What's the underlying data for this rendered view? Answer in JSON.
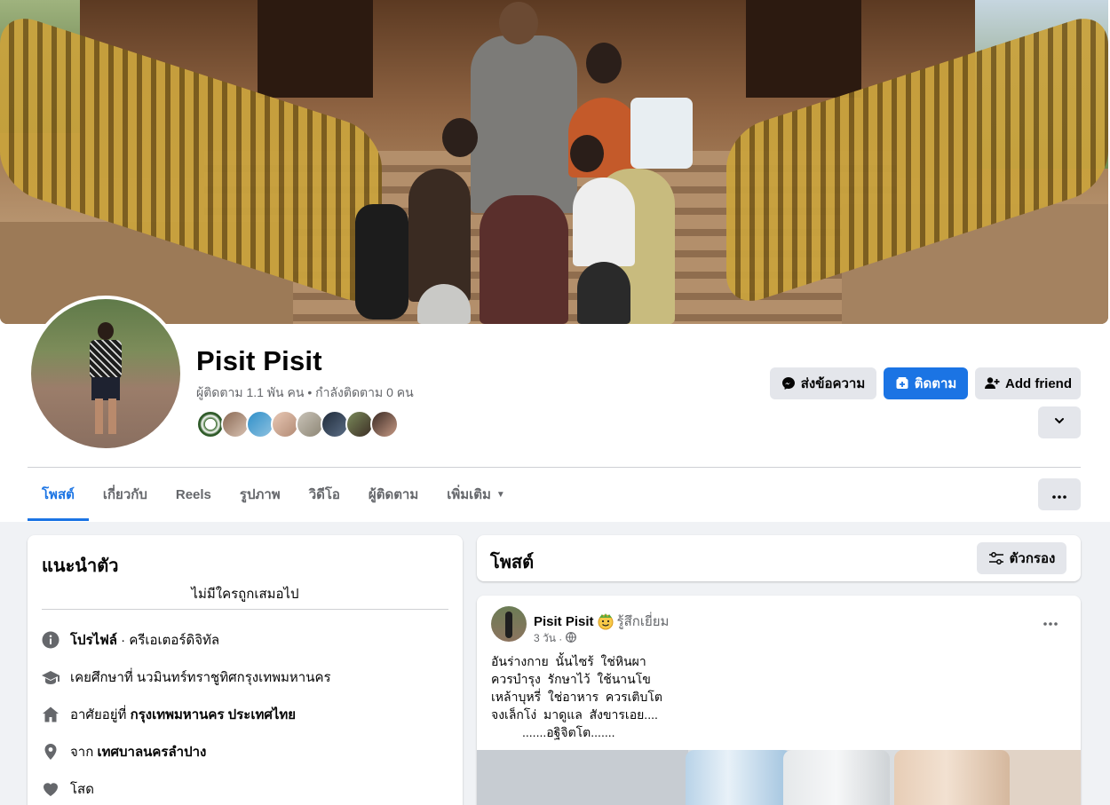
{
  "profile": {
    "name": "Pisit Pisit",
    "stats": "ผู้ติดตาม 1.1 พัน คน • กำลังติดตาม 0 คน"
  },
  "actions": {
    "message": "ส่งข้อความ",
    "follow": "ติดตาม",
    "add_friend": "Add friend"
  },
  "tabs": [
    {
      "label": "โพสต์",
      "active": true
    },
    {
      "label": "เกี่ยวกับ",
      "active": false
    },
    {
      "label": "Reels",
      "active": false
    },
    {
      "label": "รูปภาพ",
      "active": false
    },
    {
      "label": "วิดีโอ",
      "active": false
    },
    {
      "label": "ผู้ติดตาม",
      "active": false
    },
    {
      "label": "เพิ่มเติม",
      "active": false
    }
  ],
  "intro": {
    "title": "แนะนำตัว",
    "bio": "ไม่มีใครถูกเสมอไป",
    "items": [
      {
        "icon": "info-icon",
        "prefix": "",
        "bold": "โปรไฟล์",
        "suffix": " · ครีเอเตอร์ดิจิทัล"
      },
      {
        "icon": "graduation-cap-icon",
        "prefix": "เคยศึกษาที่ นวมินทร์ทราชูทิศกรุงเทพมหานคร",
        "bold": "",
        "suffix": ""
      },
      {
        "icon": "home-icon",
        "prefix": "อาศัยอยู่ที่ ",
        "bold": "กรุงเทพมหานคร ประเทศไทย",
        "suffix": ""
      },
      {
        "icon": "location-pin-icon",
        "prefix": "จาก ",
        "bold": "เทศบาลนครลำปาง",
        "suffix": ""
      },
      {
        "icon": "heart-icon",
        "prefix": "โสด",
        "bold": "",
        "suffix": ""
      }
    ]
  },
  "posts_header": {
    "title": "โพสต์",
    "filter": "ตัวกรอง"
  },
  "post": {
    "author": "Pisit Pisit",
    "feeling": "รู้สึกเยี่ยม",
    "time": "3 วัน",
    "privacy_icon": "globe-icon",
    "text": "อันร่างกาย  นั้นไซร้  ใช่หินผา\nควรบำรุง  รักษาไว้  ใช้นานโข\nเหล้าบุหรี่  ใช่อาหาร  ควรเติบโต\nจงเล็กโง่  มาดูแล  สังขารเอย....\n         .......อฐิจิตโต......."
  },
  "colors": {
    "accent": "#1b74e4",
    "secondary_text": "#65676b",
    "background": "#f0f2f5",
    "button_gray": "#e4e6eb"
  }
}
